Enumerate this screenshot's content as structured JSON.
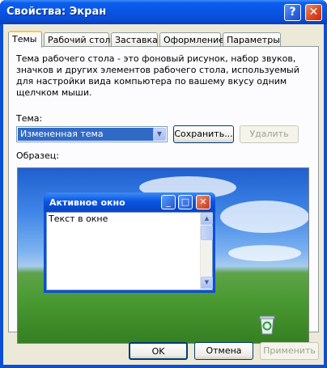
{
  "window": {
    "title": "Свойства: Экран",
    "help_glyph": "?",
    "close_glyph": "✕"
  },
  "tabs": [
    {
      "label": "Темы",
      "active": true
    },
    {
      "label": "Рабочий стол"
    },
    {
      "label": "Заставка"
    },
    {
      "label": "Оформление"
    },
    {
      "label": "Параметры"
    }
  ],
  "theme_panel": {
    "description": "Тема рабочего стола - это фоновый рисунок, набор звуков, значков и других элементов рабочего стола, используемый для настройки вида компьютера по вашему вкусу одним щелчком мыши.",
    "theme_label": "Тема:",
    "theme_value": "Измененная тема",
    "save_button": "Сохранить...",
    "delete_button": "Удалить",
    "sample_label": "Образец:"
  },
  "preview": {
    "window_title": "Активное окно",
    "window_text": "Текст в окне",
    "icons": [
      "minimize-icon",
      "maximize-icon",
      "close-icon",
      "recycle-bin-icon"
    ]
  },
  "footer": {
    "ok": "OK",
    "cancel": "Отмена",
    "apply": "Применить"
  },
  "colors": {
    "titlebar": "#0a55e3",
    "dialog_bg": "#ece9d8",
    "selection": "#316ac5",
    "tab_highlight": "#ffc83c"
  }
}
